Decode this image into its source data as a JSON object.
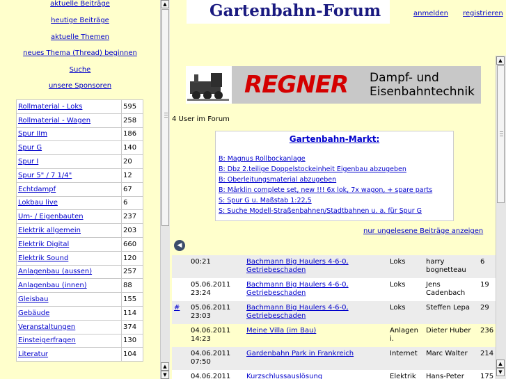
{
  "left": {
    "nav": [
      {
        "label": "aktuelle Beiträge"
      },
      {
        "label": "heutige Beiträge"
      },
      {
        "label": "aktuelle Themen"
      },
      {
        "label": "neues Thema (Thread) beginnen"
      },
      {
        "label": "Suche"
      },
      {
        "label": "unsere Sponsoren"
      }
    ],
    "categories": [
      {
        "name": "Rollmaterial - Loks",
        "count": "595"
      },
      {
        "name": "Rollmaterial - Wagen",
        "count": "258"
      },
      {
        "name": "Spur IIm",
        "count": "186"
      },
      {
        "name": "Spur G",
        "count": "140"
      },
      {
        "name": "Spur I",
        "count": "20"
      },
      {
        "name": "Spur 5\" / 7 1/4\"",
        "count": "12"
      },
      {
        "name": "Echtdampf",
        "count": "67"
      },
      {
        "name": "Lokbau live",
        "count": "6"
      },
      {
        "name": "Um- / Eigenbauten",
        "count": "237"
      },
      {
        "name": "Elektrik allgemein",
        "count": "203"
      },
      {
        "name": "Elektrik Digital",
        "count": "660"
      },
      {
        "name": "Elektrik Sound",
        "count": "120"
      },
      {
        "name": "Anlagenbau (aussen)",
        "count": "257"
      },
      {
        "name": "Anlagenbau (innen)",
        "count": "88"
      },
      {
        "name": "Gleisbau",
        "count": "155"
      },
      {
        "name": "Gebäude",
        "count": "114"
      },
      {
        "name": "Veranstaltungen",
        "count": "374"
      },
      {
        "name": "Einsteigerfragen",
        "count": "130"
      },
      {
        "name": "Literatur",
        "count": "104"
      }
    ]
  },
  "header": {
    "title": "Gartenbahn-Forum",
    "login": "anmelden",
    "register": "registrieren"
  },
  "banner": {
    "brand": "REGNER",
    "line1": "Dampf- und",
    "line2": "Eisenbahntechnik"
  },
  "users_online": "4 User im Forum",
  "market": {
    "title": "Gartenbahn-Markt:",
    "items": [
      "B: Magnus Rollbockanlage",
      "B: Dbz 2.teilige Doppelstockeinheit Eigenbau abzugeben",
      "B: Oberleitungsmaterial abzugeben",
      "B: Märklin complete set, new !!! 6x lok, 7x wagon, + spare parts",
      "S: Spur G u. Maßstab 1:22,5",
      "S: Suche Modell-Straßenbahnen/Stadtbahnen u. a. für Spur G"
    ]
  },
  "unread_link": "nur ungelesene Beiträge anzeigen",
  "threads": [
    {
      "mark": "",
      "date1": "00:21",
      "date2": "",
      "title1": "Bachmann Big Haulers 4-6-0,",
      "title2": "Getriebeschaden",
      "cat1": "Loks",
      "cat2": "",
      "user1": "harry",
      "user2": "bognetteau",
      "count": "6"
    },
    {
      "mark": "",
      "date1": "05.06.2011",
      "date2": "23:24",
      "title1": "Bachmann Big Haulers 4-6-0,",
      "title2": "Getriebeschaden",
      "cat1": "Loks",
      "cat2": "",
      "user1": "Jens",
      "user2": "Cadenbach",
      "count": "19"
    },
    {
      "mark": "#",
      "date1": "05.06.2011",
      "date2": "23:03",
      "title1": "Bachmann Big Haulers 4-6-0,",
      "title2": "Getriebeschaden",
      "cat1": "Loks",
      "cat2": "",
      "user1": "Steffen Lepa",
      "user2": "",
      "count": "29"
    },
    {
      "mark": "",
      "date1": "04.06.2011",
      "date2": "14:23",
      "title1": "Meine Villa (im Bau)",
      "title2": "",
      "cat1": "Anlagen",
      "cat2": "i.",
      "user1": "Dieter Huber",
      "user2": "",
      "count": "236"
    },
    {
      "mark": "",
      "date1": "04.06.2011",
      "date2": "07:50",
      "title1": "Gardenbahn Park in Frankreich",
      "title2": "",
      "cat1": "Internet",
      "cat2": "",
      "user1": "Marc Walter",
      "user2": "",
      "count": "214"
    },
    {
      "mark": "",
      "date1": "04.06.2011",
      "date2": "",
      "title1": "Kurzschlussauslösung",
      "title2": "",
      "cat1": "Elektrik",
      "cat2": "",
      "user1": "Hans-Peter",
      "user2": "",
      "count": "175"
    }
  ]
}
